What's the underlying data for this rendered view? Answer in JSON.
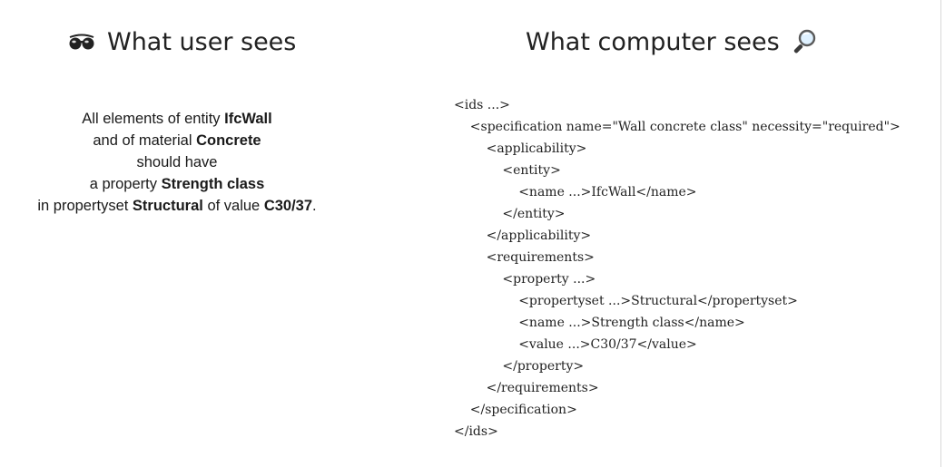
{
  "left_panel": {
    "title": "What user sees",
    "icon": "sunglasses-icon",
    "sentence": {
      "line1_prefix": "All elements of entity ",
      "entity": "IfcWall",
      "line2_prefix": "and of material ",
      "material": "Concrete",
      "line3": "should have",
      "line4_prefix": "a property ",
      "property": "Strength class",
      "line5_prefix": "in propertyset ",
      "propertyset": "Structural",
      "line5_middle": " of value ",
      "value": "C30/37",
      "line5_suffix": "."
    }
  },
  "right_panel": {
    "title": "What computer sees",
    "icon": "magnifying-glass-icon",
    "xml_lines": [
      "<ids ...>",
      "    <specification name=\"Wall concrete class\" necessity=\"required\">",
      "        <applicability>",
      "            <entity>",
      "                <name ...>IfcWall</name>",
      "            </entity>",
      "        </applicability>",
      "        <requirements>",
      "            <property ...>",
      "                <propertyset ...>Structural</propertyset>",
      "                <name ...>Strength class</name>",
      "                <value ...>C30/37</value>",
      "            </property>",
      "        </requirements>",
      "    </specification>",
      "</ids>"
    ]
  }
}
